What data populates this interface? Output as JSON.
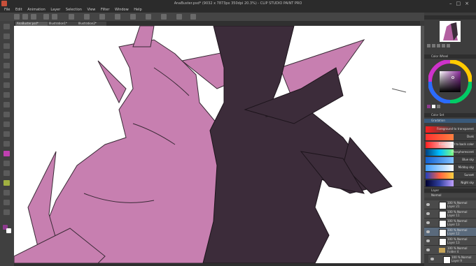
{
  "window": {
    "title": "AnaBuster.psd* (9032 x 7873px 350dpi 20.3%) - CLIP STUDIO PAINT PRO"
  },
  "menu": [
    "File",
    "Edit",
    "Animation",
    "Layer",
    "Selection",
    "View",
    "Filter",
    "Window",
    "Help"
  ],
  "tabs": [
    "AnaBuster.psd*",
    "Illustration1*",
    "Illustration2*"
  ],
  "panels": {
    "color_wheel": "Color Wheel",
    "color_set": "Color Set",
    "gradient_set_tab": "Gradation",
    "layer_panel": "Layer"
  },
  "colors": {
    "main": "#8e3a8e",
    "sub": "#ffffff",
    "accent_canvas_pink": "#c77fb0",
    "accent_canvas_dark": "#3c2c3a"
  },
  "gradients": [
    {
      "name": "Foreground to transparent"
    },
    {
      "name": "Dusk"
    },
    {
      "name": "Foreground to back color"
    },
    {
      "name": "Phosphorescent"
    },
    {
      "name": "Blue sky"
    },
    {
      "name": "Midday sky"
    },
    {
      "name": "Sunset"
    },
    {
      "name": "Night sky"
    }
  ],
  "layer_blend": "Normal",
  "layers": [
    {
      "blend": "100 % Normal",
      "name": "Layer 21"
    },
    {
      "blend": "100 % Normal",
      "name": "Layer 11"
    },
    {
      "blend": "100 % Normal",
      "name": "Layer 13"
    },
    {
      "blend": "100 % Normal",
      "name": "Layer 12"
    },
    {
      "blend": "100 % Normal",
      "name": "Layer 13"
    },
    {
      "blend": "100 % Normal",
      "name": "Folder 4"
    },
    {
      "blend": "100 % Normal",
      "name": "Layer 9"
    }
  ],
  "icons": [
    "app-icon",
    "minimize-icon",
    "maximize-icon",
    "close-icon",
    "eye-icon",
    "folder-icon"
  ]
}
